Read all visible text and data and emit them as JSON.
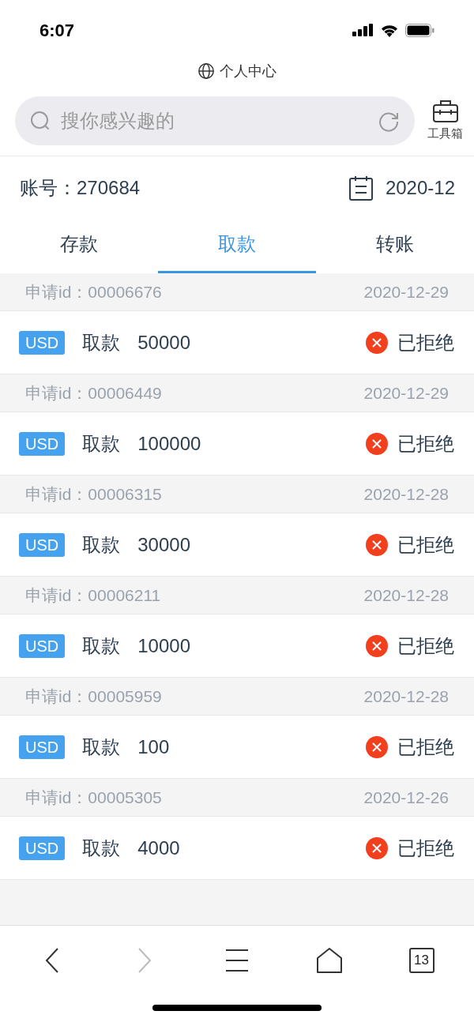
{
  "status_bar": {
    "time": "6:07"
  },
  "browser": {
    "page_title": "个人中心",
    "search": {
      "placeholder": "搜你感兴趣的"
    },
    "toolbox": {
      "label": "工具箱"
    }
  },
  "account": {
    "label": "账号：",
    "number": "270684",
    "month": "2020-12"
  },
  "tabs": [
    {
      "label": "存款",
      "selected": false
    },
    {
      "label": "取款",
      "selected": true
    },
    {
      "label": "转账",
      "selected": false
    }
  ],
  "records": [
    {
      "id_label": "申请id：",
      "id": "00006676",
      "date": "2020-12-29",
      "currency": "USD",
      "type": "取款",
      "amount": "50000",
      "status": {
        "kind": "rejected",
        "label": "已拒绝"
      }
    },
    {
      "id_label": "申请id：",
      "id": "00006449",
      "date": "2020-12-29",
      "currency": "USD",
      "type": "取款",
      "amount": "100000",
      "status": {
        "kind": "rejected",
        "label": "已拒绝"
      }
    },
    {
      "id_label": "申请id：",
      "id": "00006315",
      "date": "2020-12-28",
      "currency": "USD",
      "type": "取款",
      "amount": "30000",
      "status": {
        "kind": "rejected",
        "label": "已拒绝"
      }
    },
    {
      "id_label": "申请id：",
      "id": "00006211",
      "date": "2020-12-28",
      "currency": "USD",
      "type": "取款",
      "amount": "10000",
      "status": {
        "kind": "rejected",
        "label": "已拒绝"
      }
    },
    {
      "id_label": "申请id：",
      "id": "00005959",
      "date": "2020-12-28",
      "currency": "USD",
      "type": "取款",
      "amount": "100",
      "status": {
        "kind": "rejected",
        "label": "已拒绝"
      }
    },
    {
      "id_label": "申请id：",
      "id": "00005305",
      "date": "2020-12-26",
      "currency": "USD",
      "type": "取款",
      "amount": "4000",
      "status": {
        "kind": "rejected",
        "label": "已拒绝"
      }
    }
  ],
  "bottom_bar": {
    "back": {
      "disabled": false
    },
    "forward": {
      "disabled": true
    },
    "tab_count": "13"
  }
}
